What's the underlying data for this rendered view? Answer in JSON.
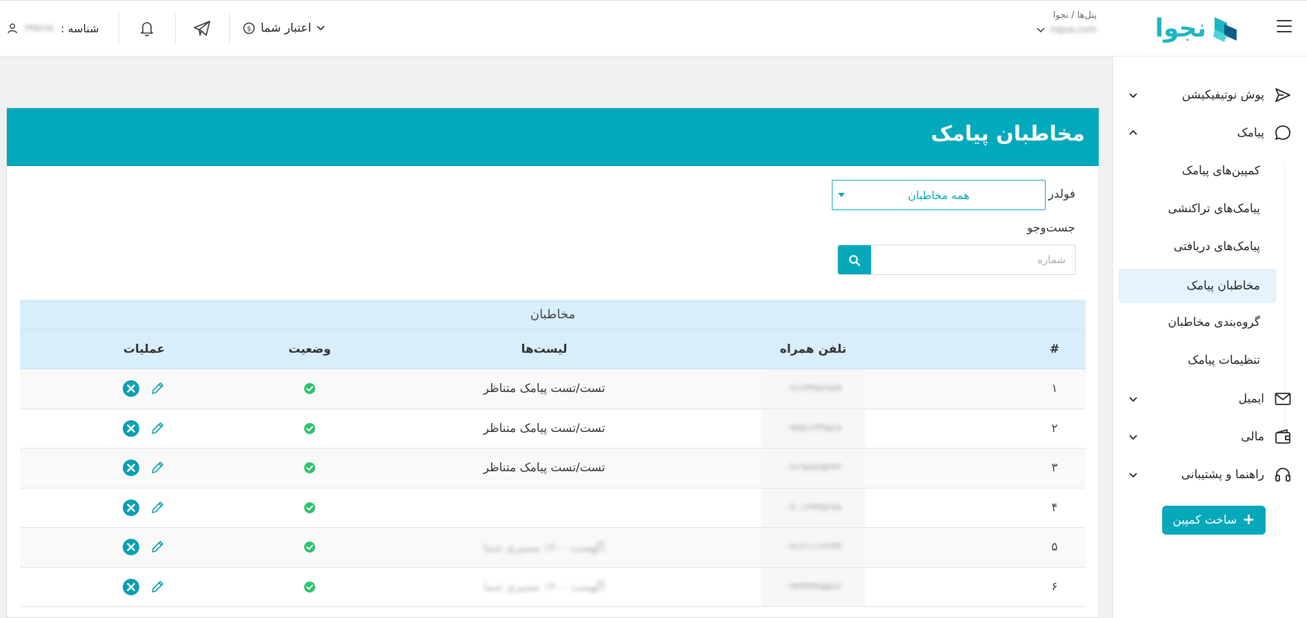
{
  "header": {
    "panel_breadcrumb": "پنل‌ها / نجوا",
    "panel_value": "najva.com",
    "logo_text": "نجوا",
    "credit_label": "اعتبار شما",
    "user_label": "شناسه :",
    "user_value": "۳۴۵۶۷۸"
  },
  "sidebar": {
    "items": [
      {
        "label": "پوش نوتیفیکیشن",
        "icon": "send-icon"
      },
      {
        "label": "پیامک",
        "icon": "chat-bubble-icon"
      },
      {
        "label": "ایمیل",
        "icon": "mail-icon"
      },
      {
        "label": "مالی",
        "icon": "wallet-icon"
      },
      {
        "label": "راهنما و پشتیبانی",
        "icon": "headset-icon"
      }
    ],
    "sms_subitems": [
      {
        "label": "کمپین‌های پیامک"
      },
      {
        "label": "پیامک‌های تراکنشی"
      },
      {
        "label": "پیامک‌های دریافتی"
      },
      {
        "label": "مخاطبان پیامک"
      },
      {
        "label": "گروه‌بندی مخاطبان"
      },
      {
        "label": "تنظیمات پیامک"
      }
    ],
    "create_button": "ساخت کمپین",
    "accent_color": "#07a8b9"
  },
  "page": {
    "title": "مخاطبان پیامک",
    "folder_label": "فولدر",
    "folder_value": "همه مخاطبان",
    "search_label": "جست‌وجو",
    "search_placeholder": "شماره"
  },
  "table": {
    "caption": "مخاطبان",
    "columns": [
      "#",
      "تلفن همراه",
      "لیست‌ها",
      "وضعیت",
      "عملیات"
    ],
    "rows": [
      {
        "idx": "۱",
        "phone": "۰۹۱۲۳۴۵۶۷۸۹",
        "lists": "تست/تست پیامک متناظر",
        "lists_blurred": false
      },
      {
        "idx": "۲",
        "phone": "۰۹۳۵۱۲۳۴۵۶۷",
        "lists": "تست/تست پیامک متناظر",
        "lists_blurred": false
      },
      {
        "idx": "۳",
        "phone": "۰۹۱۹۸۷۶۵۴۳۲",
        "lists": "تست/تست پیامک متناظر",
        "lists_blurred": false
      },
      {
        "idx": "۴",
        "phone": "۰۹۰۱۲۳۴۵۶۷۸",
        "lists": "",
        "lists_blurred": false
      },
      {
        "idx": "۵",
        "phone": "۰۹۱۲۱۱۱۲۲۳۳",
        "lists": "آگهست ۱۴۰۰ مسیری شما",
        "lists_blurred": true
      },
      {
        "idx": "۶",
        "phone": "۰۹۳۳۴۴۴۵۵۶۶",
        "lists": "آگهست ۱۴۰۰ مسیری شما",
        "lists_blurred": true
      }
    ]
  }
}
